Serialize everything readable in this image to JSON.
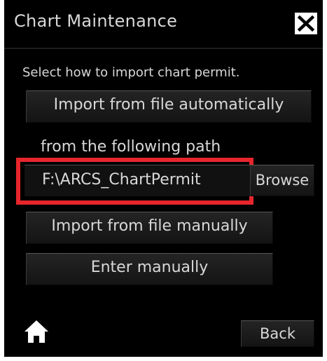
{
  "window": {
    "title": "Chart Maintenance",
    "close_icon": "close-icon"
  },
  "instruction": "Select how to import chart permit.",
  "buttons": {
    "import_auto": "Import from file automatically",
    "import_manual": "Import from file manually",
    "enter_manual": "Enter manually",
    "browse": "Browse",
    "back": "Back",
    "home_icon": "home-icon"
  },
  "path_section": {
    "label": "from the following path",
    "value": "F:\\ARCS_ChartPermit"
  },
  "colors": {
    "background": "#000000",
    "text": "#d8d8d8",
    "highlight": "#e6262c",
    "border": "#ffffff"
  }
}
